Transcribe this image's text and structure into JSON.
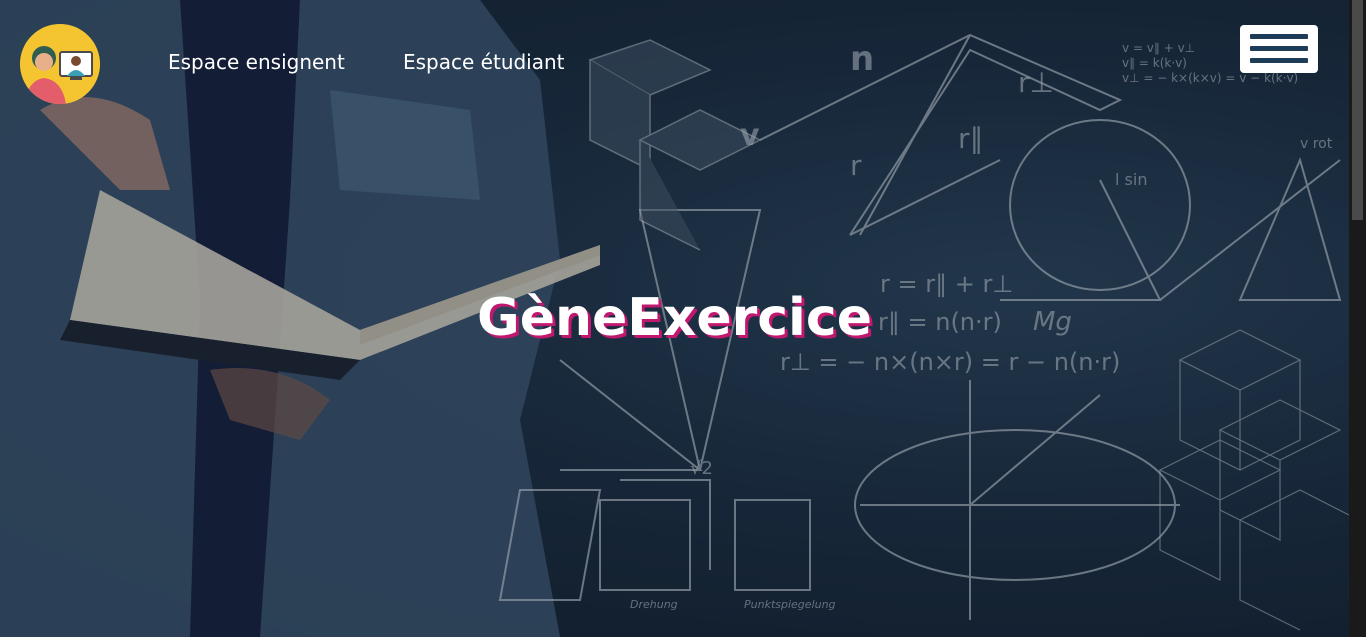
{
  "nav": {
    "links": [
      {
        "label": "Espace ensignent"
      },
      {
        "label": "Espace étudiant"
      }
    ],
    "logo_icon": "teacher-student-avatar-icon",
    "menu_icon": "hamburger-menu-icon"
  },
  "hero": {
    "title": "GèneExercice"
  },
  "colors": {
    "title_shadow": "#c0186e",
    "menu_bars": "#1d3c58",
    "logo_bg": "#f4c530"
  }
}
